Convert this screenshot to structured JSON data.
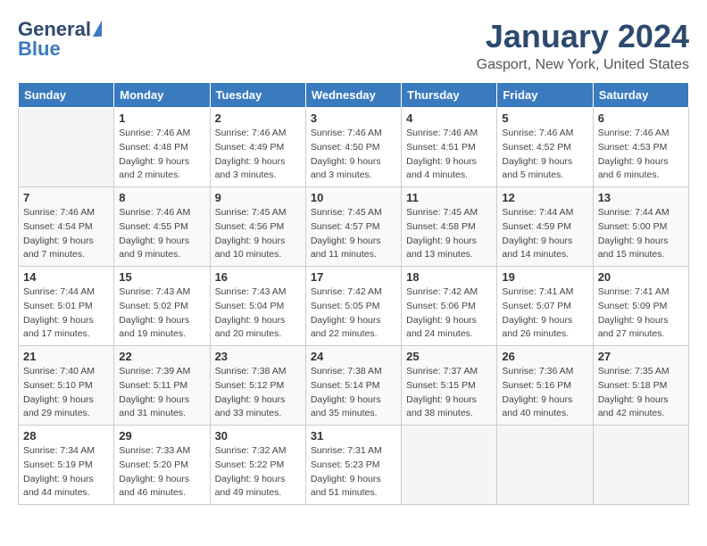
{
  "header": {
    "logo_general": "General",
    "logo_blue": "Blue",
    "month_title": "January 2024",
    "subtitle": "Gasport, New York, United States"
  },
  "calendar": {
    "days_of_week": [
      "Sunday",
      "Monday",
      "Tuesday",
      "Wednesday",
      "Thursday",
      "Friday",
      "Saturday"
    ],
    "weeks": [
      [
        {
          "day": "",
          "info": ""
        },
        {
          "day": "1",
          "info": "Sunrise: 7:46 AM\nSunset: 4:48 PM\nDaylight: 9 hours\nand 2 minutes."
        },
        {
          "day": "2",
          "info": "Sunrise: 7:46 AM\nSunset: 4:49 PM\nDaylight: 9 hours\nand 3 minutes."
        },
        {
          "day": "3",
          "info": "Sunrise: 7:46 AM\nSunset: 4:50 PM\nDaylight: 9 hours\nand 3 minutes."
        },
        {
          "day": "4",
          "info": "Sunrise: 7:46 AM\nSunset: 4:51 PM\nDaylight: 9 hours\nand 4 minutes."
        },
        {
          "day": "5",
          "info": "Sunrise: 7:46 AM\nSunset: 4:52 PM\nDaylight: 9 hours\nand 5 minutes."
        },
        {
          "day": "6",
          "info": "Sunrise: 7:46 AM\nSunset: 4:53 PM\nDaylight: 9 hours\nand 6 minutes."
        }
      ],
      [
        {
          "day": "7",
          "info": "Sunrise: 7:46 AM\nSunset: 4:54 PM\nDaylight: 9 hours\nand 7 minutes."
        },
        {
          "day": "8",
          "info": "Sunrise: 7:46 AM\nSunset: 4:55 PM\nDaylight: 9 hours\nand 9 minutes."
        },
        {
          "day": "9",
          "info": "Sunrise: 7:45 AM\nSunset: 4:56 PM\nDaylight: 9 hours\nand 10 minutes."
        },
        {
          "day": "10",
          "info": "Sunrise: 7:45 AM\nSunset: 4:57 PM\nDaylight: 9 hours\nand 11 minutes."
        },
        {
          "day": "11",
          "info": "Sunrise: 7:45 AM\nSunset: 4:58 PM\nDaylight: 9 hours\nand 13 minutes."
        },
        {
          "day": "12",
          "info": "Sunrise: 7:44 AM\nSunset: 4:59 PM\nDaylight: 9 hours\nand 14 minutes."
        },
        {
          "day": "13",
          "info": "Sunrise: 7:44 AM\nSunset: 5:00 PM\nDaylight: 9 hours\nand 15 minutes."
        }
      ],
      [
        {
          "day": "14",
          "info": "Sunrise: 7:44 AM\nSunset: 5:01 PM\nDaylight: 9 hours\nand 17 minutes."
        },
        {
          "day": "15",
          "info": "Sunrise: 7:43 AM\nSunset: 5:02 PM\nDaylight: 9 hours\nand 19 minutes."
        },
        {
          "day": "16",
          "info": "Sunrise: 7:43 AM\nSunset: 5:04 PM\nDaylight: 9 hours\nand 20 minutes."
        },
        {
          "day": "17",
          "info": "Sunrise: 7:42 AM\nSunset: 5:05 PM\nDaylight: 9 hours\nand 22 minutes."
        },
        {
          "day": "18",
          "info": "Sunrise: 7:42 AM\nSunset: 5:06 PM\nDaylight: 9 hours\nand 24 minutes."
        },
        {
          "day": "19",
          "info": "Sunrise: 7:41 AM\nSunset: 5:07 PM\nDaylight: 9 hours\nand 26 minutes."
        },
        {
          "day": "20",
          "info": "Sunrise: 7:41 AM\nSunset: 5:09 PM\nDaylight: 9 hours\nand 27 minutes."
        }
      ],
      [
        {
          "day": "21",
          "info": "Sunrise: 7:40 AM\nSunset: 5:10 PM\nDaylight: 9 hours\nand 29 minutes."
        },
        {
          "day": "22",
          "info": "Sunrise: 7:39 AM\nSunset: 5:11 PM\nDaylight: 9 hours\nand 31 minutes."
        },
        {
          "day": "23",
          "info": "Sunrise: 7:38 AM\nSunset: 5:12 PM\nDaylight: 9 hours\nand 33 minutes."
        },
        {
          "day": "24",
          "info": "Sunrise: 7:38 AM\nSunset: 5:14 PM\nDaylight: 9 hours\nand 35 minutes."
        },
        {
          "day": "25",
          "info": "Sunrise: 7:37 AM\nSunset: 5:15 PM\nDaylight: 9 hours\nand 38 minutes."
        },
        {
          "day": "26",
          "info": "Sunrise: 7:36 AM\nSunset: 5:16 PM\nDaylight: 9 hours\nand 40 minutes."
        },
        {
          "day": "27",
          "info": "Sunrise: 7:35 AM\nSunset: 5:18 PM\nDaylight: 9 hours\nand 42 minutes."
        }
      ],
      [
        {
          "day": "28",
          "info": "Sunrise: 7:34 AM\nSunset: 5:19 PM\nDaylight: 9 hours\nand 44 minutes."
        },
        {
          "day": "29",
          "info": "Sunrise: 7:33 AM\nSunset: 5:20 PM\nDaylight: 9 hours\nand 46 minutes."
        },
        {
          "day": "30",
          "info": "Sunrise: 7:32 AM\nSunset: 5:22 PM\nDaylight: 9 hours\nand 49 minutes."
        },
        {
          "day": "31",
          "info": "Sunrise: 7:31 AM\nSunset: 5:23 PM\nDaylight: 9 hours\nand 51 minutes."
        },
        {
          "day": "",
          "info": ""
        },
        {
          "day": "",
          "info": ""
        },
        {
          "day": "",
          "info": ""
        }
      ]
    ]
  }
}
